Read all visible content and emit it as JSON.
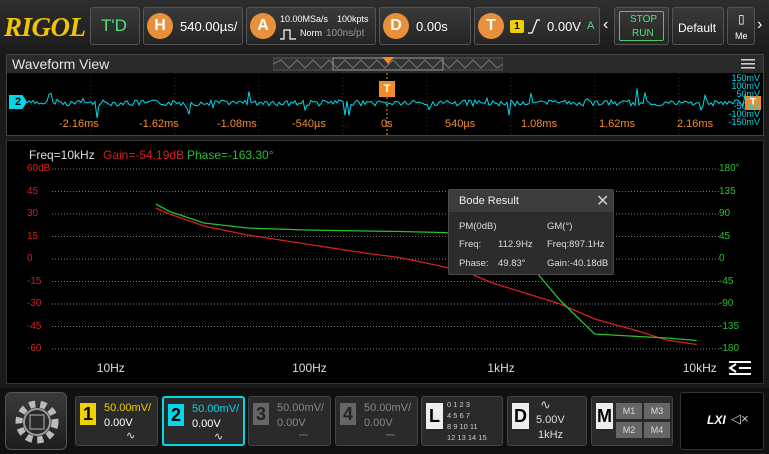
{
  "app": {
    "brand": "RIGOL"
  },
  "topbar": {
    "trigger_mode": "T'D",
    "horizontal": {
      "label": "H",
      "timebase": "540.00µs/"
    },
    "acquire": {
      "label": "A",
      "sample_rate": "10.00MSa/s",
      "memory": "100kpts",
      "mode": "Norm",
      "time_per_point": "100ns/pt"
    },
    "delay": {
      "label": "D",
      "value": "0.00s"
    },
    "trigger": {
      "label": "T",
      "source": "1",
      "level": "0.00V",
      "sweep": "A"
    },
    "run_state": {
      "line1": "STOP",
      "line2": "RUN"
    },
    "default_label": "Default",
    "menu_label": "Me"
  },
  "waveform": {
    "title": "Waveform View",
    "channel_marker": "2",
    "trigger_marker": "T",
    "time_labels": [
      "-2.16ms",
      "-1.62ms",
      "-1.08ms",
      "-540µs",
      "0s",
      "540µs",
      "1.08ms",
      "1.62ms",
      "2.16ms"
    ],
    "volt_labels": [
      "150mV",
      "100mV",
      "50mV",
      "-50mV",
      "-100mV",
      "-150mV"
    ]
  },
  "bode": {
    "freq_text": "Freq=10kHz",
    "gain_text": "Gain=-54.19dB",
    "phase_text": "Phase=-163.30°",
    "gain_color": "#d42020",
    "phase_color": "#26c030",
    "gain_axis": [
      "60dB",
      "45",
      "30",
      "15",
      "0",
      "-15",
      "-30",
      "-45",
      "-60"
    ],
    "phase_axis": [
      "180°",
      "135",
      "90",
      "45",
      "0",
      "-45",
      "-90",
      "-135",
      "-180"
    ],
    "freq_axis": [
      "10Hz",
      "100Hz",
      "1kHz",
      "10kHz"
    ],
    "result": {
      "title": "Bode Result",
      "pm_label": "PM(0dB)",
      "gm_label": "GM(°)",
      "pm_freq_label": "Freq:",
      "pm_freq_value": "112.9Hz",
      "gm_freq": "Freq:897.1Hz",
      "phase_label": "Phase:",
      "phase_value": "49.83°",
      "gain": "Gain:-40.18dB"
    }
  },
  "chart_data": {
    "type": "line",
    "x_scale": "log",
    "x": [
      17,
      20,
      30,
      50,
      100,
      200,
      300,
      500,
      700,
      900,
      1200,
      2000,
      3000,
      5000,
      7000,
      10000
    ],
    "xlim": [
      5,
      13000
    ],
    "tick_labels_x": [
      "10Hz",
      "100Hz",
      "1kHz",
      "10kHz"
    ],
    "series": [
      {
        "values": [
          34,
          30,
          22,
          16,
          10,
          4,
          1,
          -5,
          -10,
          -16,
          -21,
          -30,
          -40,
          -48,
          -54,
          -57
        ]
      },
      {
        "values": [
          110,
          95,
          72,
          62,
          58,
          56,
          55,
          53,
          50,
          43,
          20,
          -83,
          -150,
          -155,
          -158,
          -163
        ]
      }
    ],
    "ylim_left": [
      -60,
      60
    ],
    "ylim_right": [
      -180,
      180
    ],
    "grid": true
  },
  "bottombar": {
    "channels": [
      {
        "num": "1",
        "scale": "50.00mV/",
        "offset": "0.00V",
        "coupling": "∿",
        "color": "#f0d000",
        "active": true
      },
      {
        "num": "2",
        "scale": "50.00mV/",
        "offset": "0.00V",
        "coupling": "∿",
        "color": "#00d8e8",
        "active": true
      },
      {
        "num": "3",
        "scale": "50.00mV/",
        "offset": "0.00V",
        "coupling": "⎓",
        "color": "#888888",
        "active": false
      },
      {
        "num": "4",
        "scale": "50.00mV/",
        "offset": "0.00V",
        "coupling": "⎓",
        "color": "#888888",
        "active": false
      }
    ],
    "logic": {
      "label": "L",
      "rows": [
        "0 1 2 3",
        "4 5 6 7",
        "8 9 10 11",
        "12 13 14 15"
      ]
    },
    "dvm": {
      "label": "D",
      "value": "5.00V",
      "freq": "1kHz"
    },
    "math": {
      "label": "M",
      "items": [
        "M1",
        "M3",
        "M2",
        "M4"
      ]
    },
    "lxi_label": "LXI"
  }
}
